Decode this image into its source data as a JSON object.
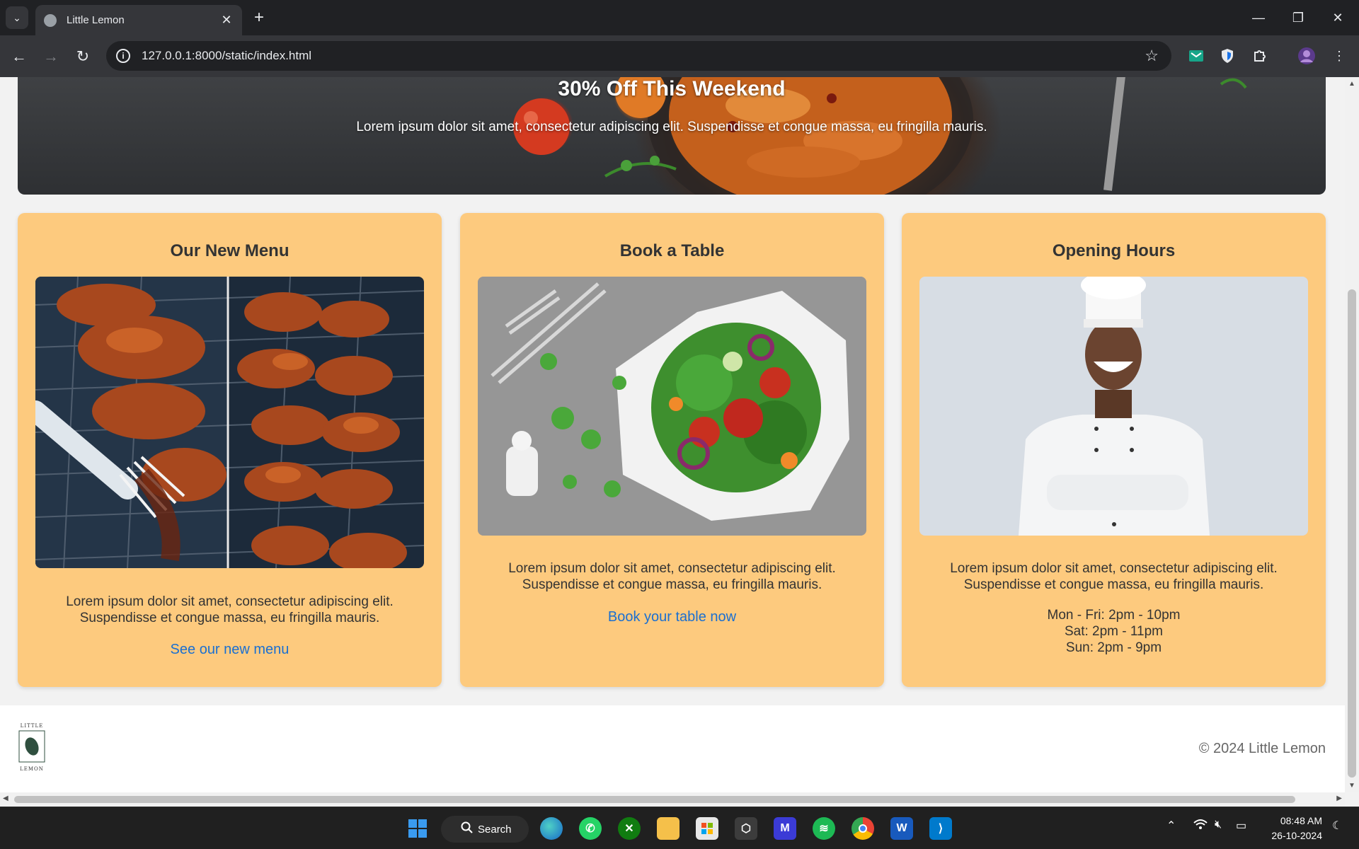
{
  "browser": {
    "tab_title": "Little Lemon",
    "url": "127.0.0.1:8000/static/index.html"
  },
  "promo": {
    "title": "30% Off This Weekend",
    "text": "Lorem ipsum dolor sit amet, consectetur adipiscing elit. Suspendisse et congue massa, eu fringilla mauris."
  },
  "cards": [
    {
      "title": "Our New Menu",
      "text_line1": "Lorem ipsum dolor sit amet, consectetur adipiscing elit.",
      "text_line2": "Suspendisse et congue massa, eu fringilla mauris.",
      "link": "See our new menu"
    },
    {
      "title": "Book a Table",
      "text_line1": "Lorem ipsum dolor sit amet, consectetur adipiscing elit.",
      "text_line2": "Suspendisse et congue massa, eu fringilla mauris.",
      "link": "Book your table now"
    },
    {
      "title": "Opening Hours",
      "text_line1": "Lorem ipsum dolor sit amet, consectetur adipiscing elit.",
      "text_line2": "Suspendisse et congue massa, eu fringilla mauris.",
      "hours": [
        "Mon - Fri: 2pm - 10pm",
        "Sat: 2pm - 11pm",
        "Sun: 2pm - 9pm"
      ]
    }
  ],
  "footer": {
    "logo_text_top": "LITTLE",
    "logo_text_bottom": "LEMON",
    "copyright": "© 2024 Little Lemon"
  },
  "taskbar": {
    "search_label": "Search",
    "time": "08:48 AM",
    "date": "26-10-2024"
  },
  "colors": {
    "card_bg": "#fdca7e",
    "link": "#1a6fd1",
    "footer_bg": "#ffffff",
    "page_bg": "#f2f2f2"
  }
}
